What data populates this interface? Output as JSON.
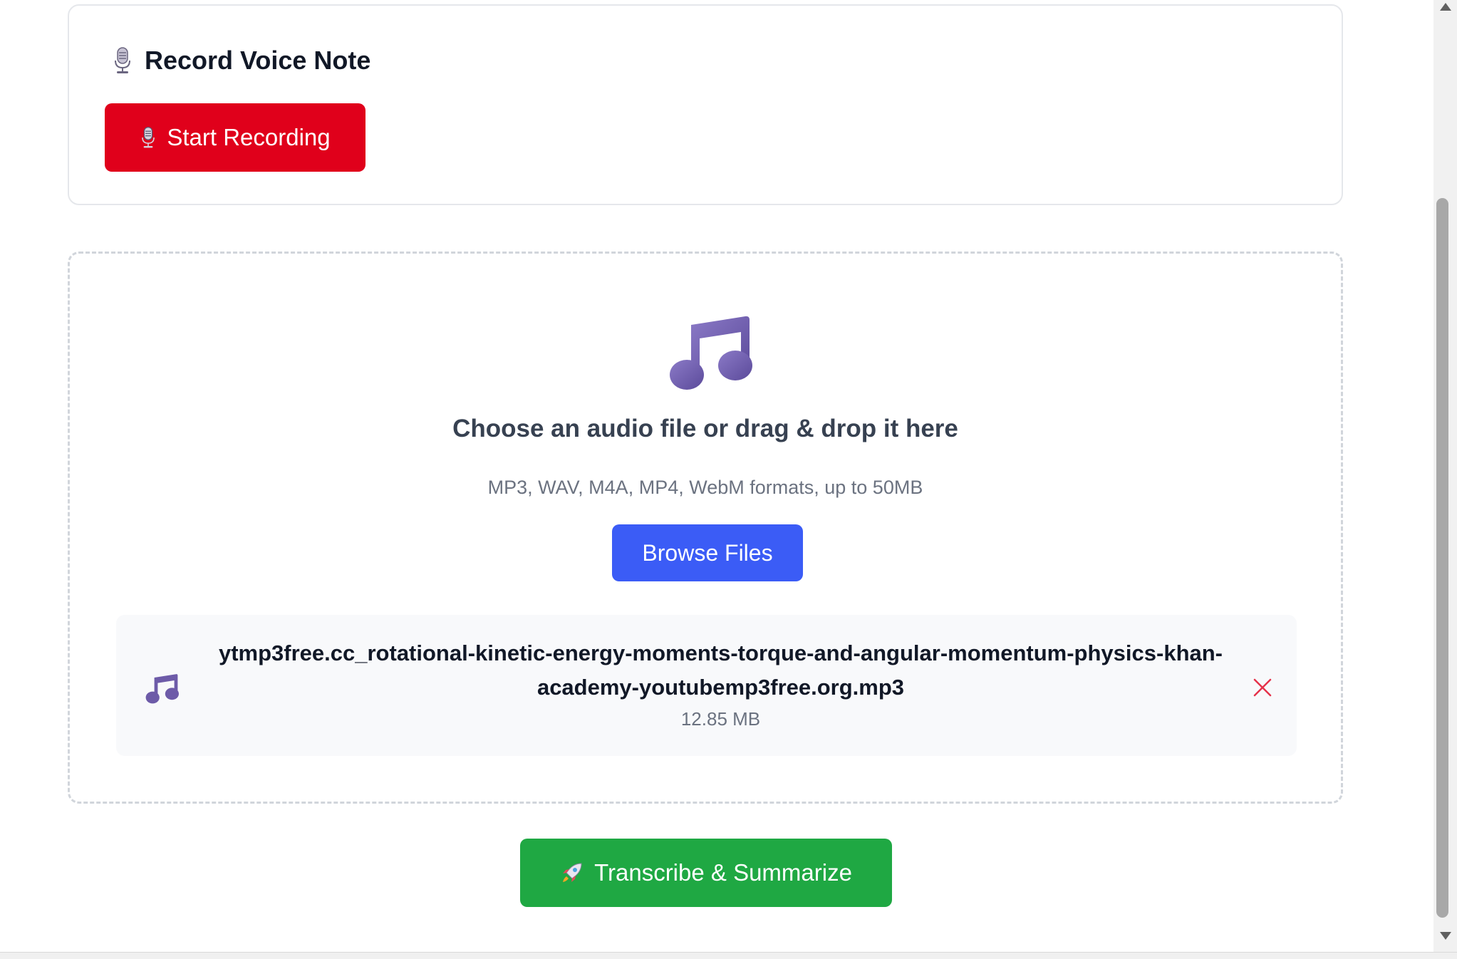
{
  "record": {
    "title": "Record Voice Note",
    "title_icon": "microphone-icon",
    "start_button_label": "Start Recording",
    "start_button_icon": "microphone-icon",
    "button_color": "#e0001b"
  },
  "upload": {
    "icon": "music-note-icon",
    "heading": "Choose an audio file or drag & drop it here",
    "subtext": "MP3, WAV, M4A, MP4, WebM formats, up to 50MB",
    "browse_label": "Browse Files",
    "browse_color": "#3b5cf6",
    "file": {
      "icon": "music-note-icon",
      "name": "ytmp3free.cc_rotational-kinetic-energy-moments-torque-and-angular-momentum-physics-khan-academy-youtubemp3free.org.mp3",
      "size": "12.85 MB",
      "remove_icon": "close-icon"
    }
  },
  "transcribe": {
    "label": "Transcribe & Summarize",
    "icon": "rocket-icon",
    "color": "#1fa843"
  }
}
